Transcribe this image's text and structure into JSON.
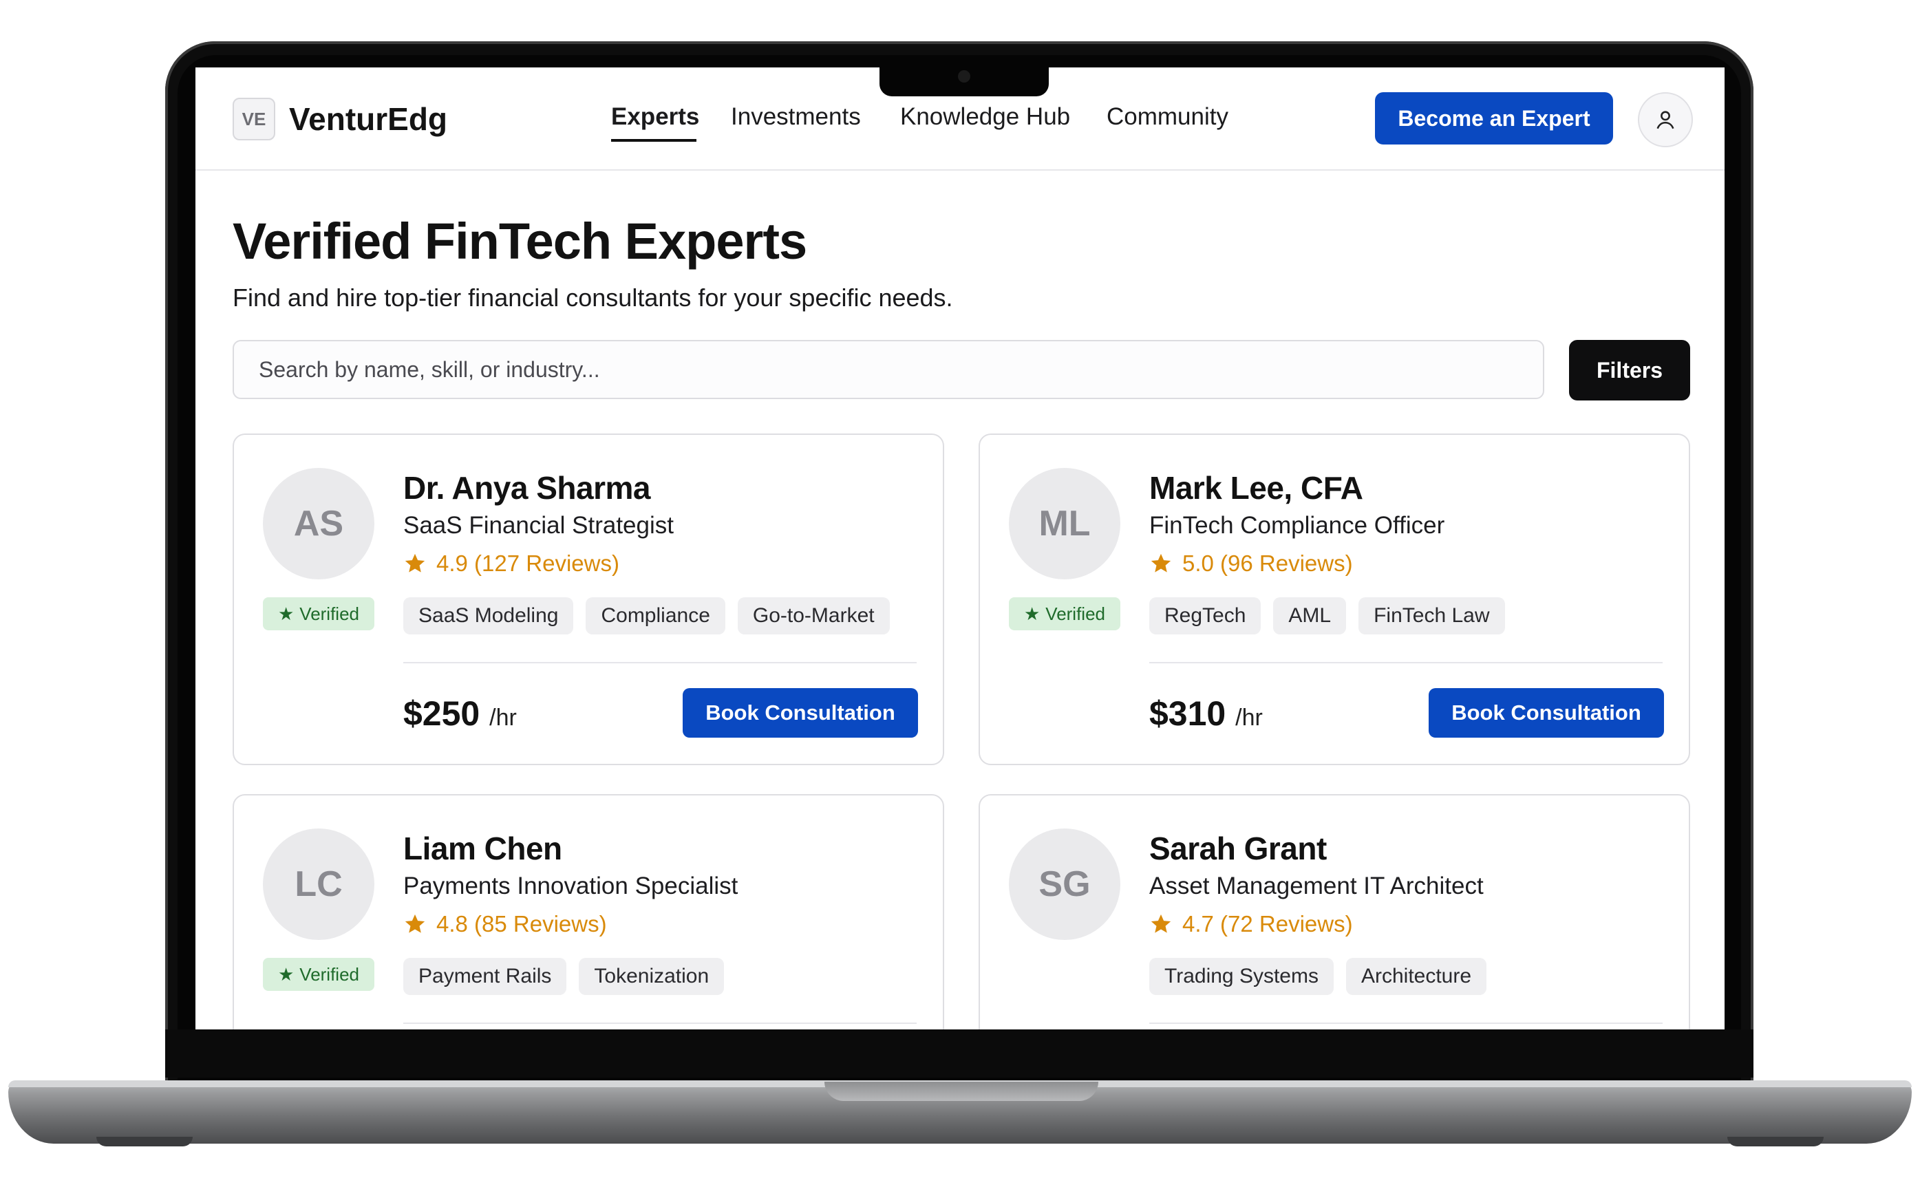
{
  "app": {
    "logo_badge": "VE",
    "logo_text": "VenturEdg"
  },
  "nav": {
    "items": [
      {
        "label": "Experts",
        "active": true
      },
      {
        "label": "Investments",
        "active": false
      },
      {
        "label": "Knowledge Hub",
        "active": false
      },
      {
        "label": "Community",
        "active": false
      }
    ],
    "cta_label": "Become an Expert",
    "profile_icon": "user-icon"
  },
  "page": {
    "title": "Verified FinTech Experts",
    "subtitle": "Find and hire top-tier financial consultants for your specific needs."
  },
  "search": {
    "placeholder": "Search by name, skill, or industry...",
    "filters_label": "Filters"
  },
  "experts": [
    {
      "initials": "AS",
      "name": "Dr. Anya Sharma",
      "role": "SaaS Financial Strategist",
      "rating": "4.9 (127 Reviews)",
      "verified": "Verified",
      "tags": [
        "SaaS Modeling",
        "Compliance",
        "Go-to-Market"
      ],
      "price": "$250",
      "unit": "/hr",
      "cta": "Book Consultation"
    },
    {
      "initials": "ML",
      "name": "Mark Lee, CFA",
      "role": "FinTech Compliance Officer",
      "rating": "5.0 (96 Reviews)",
      "verified": "Verified",
      "tags": [
        "RegTech",
        "AML",
        "FinTech Law"
      ],
      "price": "$310",
      "unit": "/hr",
      "cta": "Book Consultation"
    },
    {
      "initials": "LC",
      "name": "Liam Chen",
      "role": "Payments Innovation Specialist",
      "rating": "4.8 (85 Reviews)",
      "verified": "Verified",
      "tags": [
        "Payment Rails",
        "Tokenization"
      ]
    },
    {
      "initials": "SG",
      "name": "Sarah Grant",
      "role": "Asset Management IT Architect",
      "rating": "4.7 (72 Reviews)",
      "tags": [
        "Trading Systems",
        "Architecture"
      ]
    }
  ],
  "colors": {
    "accent": "#0a49c1",
    "rating": "#d98a0a",
    "verified_bg": "#d9f0dc",
    "verified_fg": "#1f6b2b"
  },
  "icons": {
    "star": "star-icon",
    "verified": "verified-star-icon"
  }
}
